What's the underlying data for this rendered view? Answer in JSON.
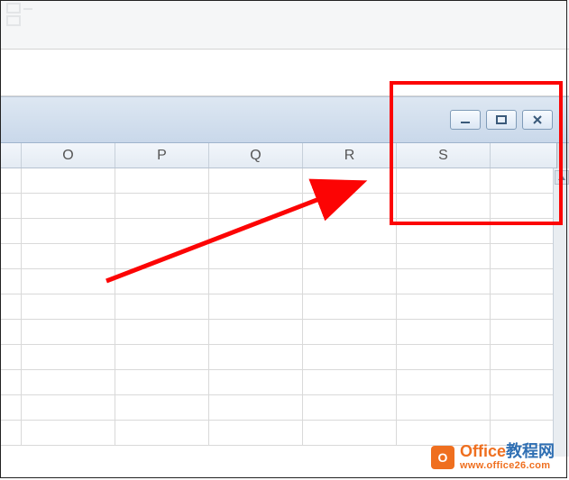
{
  "columns": [
    "O",
    "P",
    "Q",
    "R",
    "S"
  ],
  "window_controls": {
    "minimize": "minimize",
    "maximize": "maximize",
    "close": "close"
  },
  "watermark": {
    "badge_letter": "O",
    "title_part1": "Office",
    "title_part2": "教程网",
    "url": "www.office26.com"
  },
  "annotation": {
    "highlight_color": "#fc0404"
  }
}
